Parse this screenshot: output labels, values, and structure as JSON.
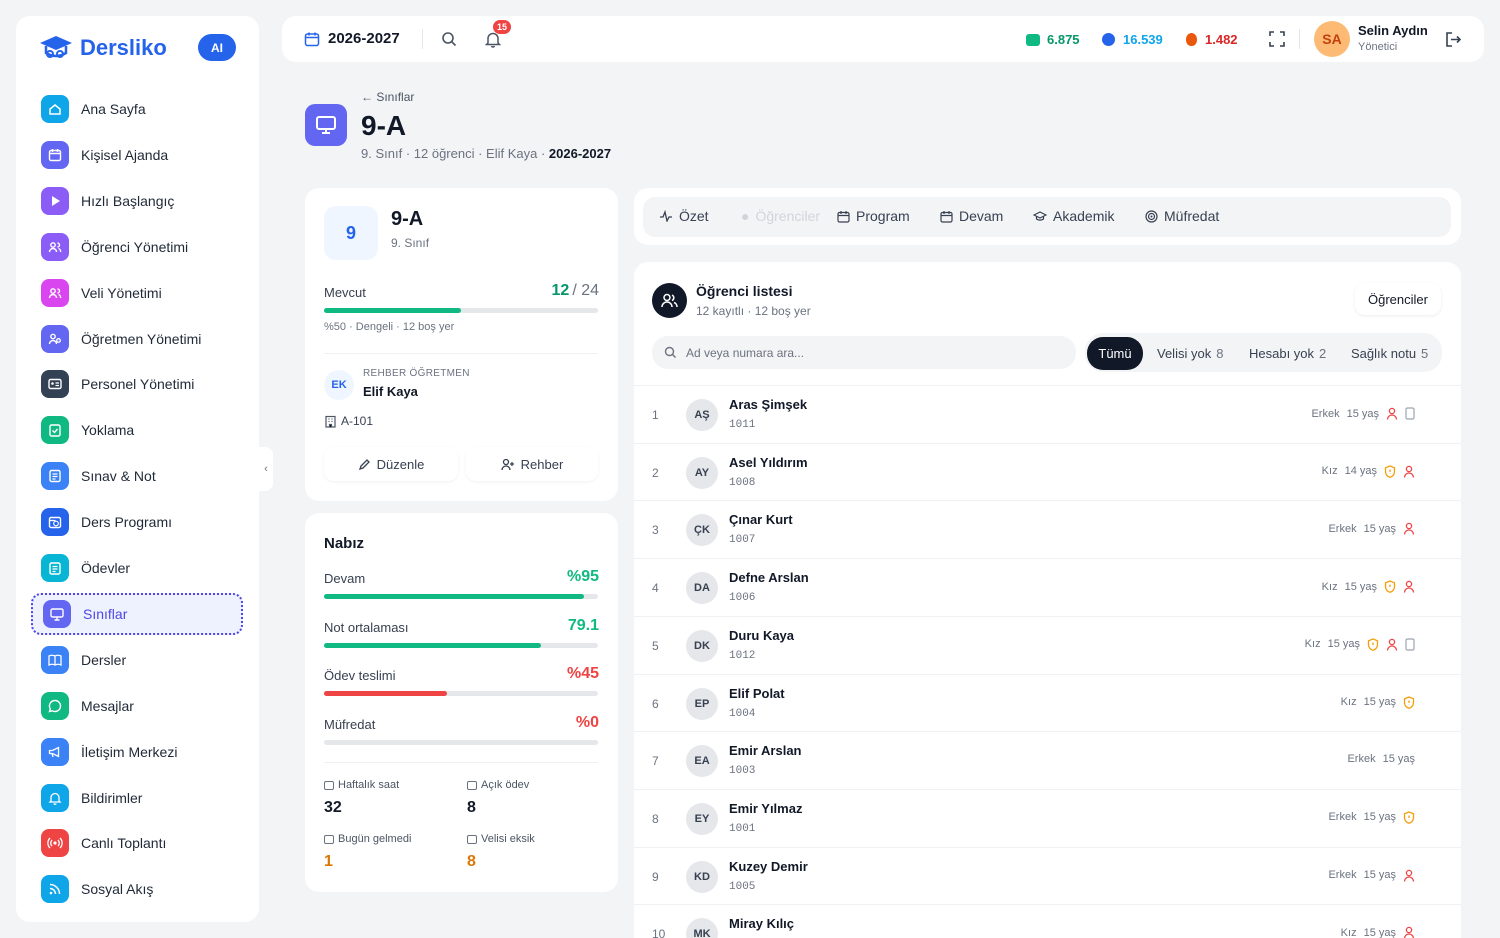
{
  "brand": {
    "name": "Dersliko",
    "ai": "AI",
    "primary": "#2563eb"
  },
  "sidebar": {
    "items": [
      {
        "label": "Ana Sayfa",
        "icon": "home-icon",
        "color": "#0ea5e9"
      },
      {
        "label": "Kişisel Ajanda",
        "icon": "calendar-icon",
        "color": "#6366f1"
      },
      {
        "label": "Hızlı Başlangıç",
        "icon": "play-icon",
        "color": "#8b5cf6"
      },
      {
        "label": "Öğrenci Yönetimi",
        "icon": "users-icon",
        "color": "#8b5cf6"
      },
      {
        "label": "Veli Yönetimi",
        "icon": "users-icon",
        "color": "#d946ef"
      },
      {
        "label": "Öğretmen Yönetimi",
        "icon": "teacher-icon",
        "color": "#6366f1"
      },
      {
        "label": "Personel Yönetimi",
        "icon": "id-card-icon",
        "color": "#334155"
      },
      {
        "label": "Yoklama",
        "icon": "clipboard-check-icon",
        "color": "#10b981"
      },
      {
        "label": "Sınav & Not",
        "icon": "exam-icon",
        "color": "#3b82f6"
      },
      {
        "label": "Ders Programı",
        "icon": "schedule-icon",
        "color": "#2563eb"
      },
      {
        "label": "Ödevler",
        "icon": "clipboard-icon",
        "color": "#06b6d4"
      },
      {
        "label": "Sınıflar",
        "icon": "presentation-icon",
        "color": "#6366f1"
      },
      {
        "label": "Dersler",
        "icon": "book-icon",
        "color": "#3b82f6"
      },
      {
        "label": "Mesajlar",
        "icon": "chat-icon",
        "color": "#10b981"
      },
      {
        "label": "İletişim Merkezi",
        "icon": "megaphone-icon",
        "color": "#3b82f6"
      },
      {
        "label": "Bildirimler",
        "icon": "bell-icon",
        "color": "#0ea5e9"
      },
      {
        "label": "Canlı Toplantı",
        "icon": "broadcast-icon",
        "color": "#ef4444"
      },
      {
        "label": "Sosyal Akış",
        "icon": "rss-icon",
        "color": "#0ea5e9"
      }
    ]
  },
  "header": {
    "year": "2026-2027",
    "notifications": "15",
    "stats": [
      "6.875",
      "16.539",
      "1.482"
    ],
    "user": {
      "initials": "SA",
      "name": "Selin Aydın",
      "role": "Yönetici"
    }
  },
  "page": {
    "breadcrumb": "Sınıflar",
    "title": "9-A",
    "sub": [
      "9. Sınıf",
      "12 öğrenci",
      "Elif Kaya",
      "2026-2027"
    ]
  },
  "classcard": {
    "badge": "9",
    "name": "9-A",
    "grade": "9. Sınıf",
    "mevcut_label": "Mevcut",
    "mevcut_val": "12",
    "mevcut_cap": "/ 24",
    "fill_fraction": 0.5,
    "capacity_note": "%50 · Dengeli · 12 boş yer",
    "teacher_role": "REHBER ÖĞRETMEN",
    "teacher_initials": "EK",
    "teacher_name": "Elif Kaya",
    "room": "A-101",
    "edit": "Düzenle",
    "guide": "Rehber"
  },
  "nabiz": {
    "title": "Nabız",
    "metrics": [
      {
        "label": "Devam",
        "value": "%95",
        "fraction": 0.95,
        "color": "#10b981"
      },
      {
        "label": "Not ortalaması",
        "value": "79.1",
        "fraction": 0.791,
        "color": "#10b981"
      },
      {
        "label": "Ödev teslimi",
        "value": "%45",
        "fraction": 0.45,
        "color": "#ef4444"
      },
      {
        "label": "Müfredat",
        "value": "%0",
        "fraction": 0,
        "color": "#ef4444"
      }
    ],
    "facts": [
      {
        "label": "Haftalık saat",
        "value": "32",
        "color": "#111827"
      },
      {
        "label": "Açık ödev",
        "value": "8",
        "color": "#111827"
      },
      {
        "label": "Bugün gelmedi",
        "value": "1",
        "color": "#d97706"
      },
      {
        "label": "Velisi eksik",
        "value": "8",
        "color": "#d97706"
      }
    ]
  },
  "tabs": [
    "Özet",
    "Öğrenciler",
    "Program",
    "Devam",
    "Akademik",
    "Müfredat"
  ],
  "list": {
    "title": "Öğrenci listesi",
    "subtitle": "12 kayıtlı · 12 boş yer",
    "button": "Öğrenciler",
    "search_placeholder": "Ad veya numara ara...",
    "filters": [
      {
        "label": "Tümü",
        "count": ""
      },
      {
        "label": "Velisi yok",
        "count": "8"
      },
      {
        "label": "Hesabı yok",
        "count": "2"
      },
      {
        "label": "Sağlık notu",
        "count": "5"
      }
    ],
    "students": [
      {
        "n": "1",
        "ini": "AŞ",
        "name": "Aras Şimşek",
        "no": "1011",
        "gender": "Erkek",
        "age": "15 yaş",
        "health": false,
        "noparent": true,
        "noacc": true
      },
      {
        "n": "2",
        "ini": "AY",
        "name": "Asel Yıldırım",
        "no": "1008",
        "gender": "Kız",
        "age": "14 yaş",
        "health": true,
        "noparent": true,
        "noacc": false
      },
      {
        "n": "3",
        "ini": "ÇK",
        "name": "Çınar Kurt",
        "no": "1007",
        "gender": "Erkek",
        "age": "15 yaş",
        "health": false,
        "noparent": true,
        "noacc": false
      },
      {
        "n": "4",
        "ini": "DA",
        "name": "Defne Arslan",
        "no": "1006",
        "gender": "Kız",
        "age": "15 yaş",
        "health": true,
        "noparent": true,
        "noacc": false
      },
      {
        "n": "5",
        "ini": "DK",
        "name": "Duru Kaya",
        "no": "1012",
        "gender": "Kız",
        "age": "15 yaş",
        "health": true,
        "noparent": true,
        "noacc": true
      },
      {
        "n": "6",
        "ini": "EP",
        "name": "Elif Polat",
        "no": "1004",
        "gender": "Kız",
        "age": "15 yaş",
        "health": true,
        "noparent": false,
        "noacc": false
      },
      {
        "n": "7",
        "ini": "EA",
        "name": "Emir Arslan",
        "no": "1003",
        "gender": "Erkek",
        "age": "15 yaş",
        "health": false,
        "noparent": false,
        "noacc": false
      },
      {
        "n": "8",
        "ini": "EY",
        "name": "Emir Yılmaz",
        "no": "1001",
        "gender": "Erkek",
        "age": "15 yaş",
        "health": true,
        "noparent": false,
        "noacc": false
      },
      {
        "n": "9",
        "ini": "KD",
        "name": "Kuzey Demir",
        "no": "1005",
        "gender": "Erkek",
        "age": "15 yaş",
        "health": false,
        "noparent": true,
        "noacc": false
      },
      {
        "n": "10",
        "ini": "MK",
        "name": "Miray Kılıç",
        "no": "",
        "gender": "Kız",
        "age": "15 yaş",
        "health": false,
        "noparent": true,
        "noacc": false
      }
    ]
  }
}
